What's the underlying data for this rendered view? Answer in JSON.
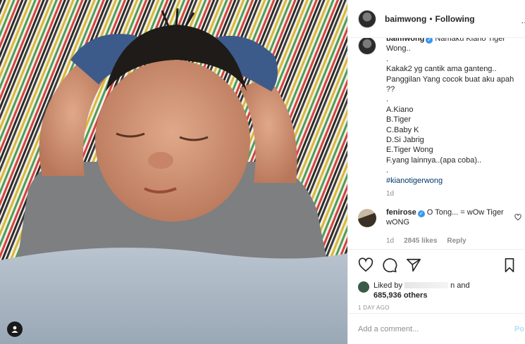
{
  "post": {
    "username": "baimwong",
    "follow_label": "Following",
    "dot": "•",
    "more": "…"
  },
  "caption": {
    "username": "baimwong",
    "first_line": "Namaku Kiano Tiger Wong..",
    "body": ".\nKakak2 yg cantik ama ganteng..\nPanggilan Yang cocok buat aku apah ??\n.\nA.Kiano\nB.Tiger\nC.Baby K\nD.Si Jabrig\nE.Tiger Wong\nF.yang lainnya..(apa coba)..\n.",
    "hashtag": "#kianotigerwong",
    "time": "1d"
  },
  "comment": {
    "username": "fenirose",
    "text": "O Tong... = wOw Tiger wONG",
    "time": "1d",
    "likes": "2845 likes",
    "reply": "Reply"
  },
  "likes": {
    "prefix": "Liked by",
    "tail": "n and",
    "count": "685,936 others",
    "ago": "1 DAY AGO"
  },
  "add_comment": {
    "placeholder": "Add a comment...",
    "post_label": "Po"
  },
  "icons": [
    "user-tag-icon",
    "heart-icon",
    "comment-icon",
    "share-icon",
    "bookmark-icon",
    "verified-icon"
  ],
  "colors": {
    "verified": "#3897f0",
    "hashtag": "#00376b",
    "muted": "#8e8e8e"
  }
}
